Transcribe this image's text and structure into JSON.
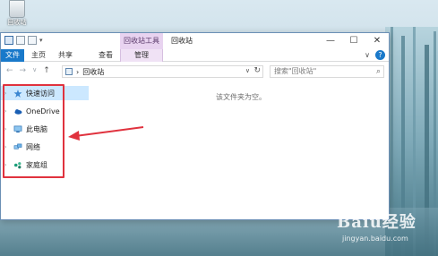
{
  "desktop": {
    "recycle_bin_label": "回收站"
  },
  "window": {
    "context_tab": "回收站工具",
    "title": "回收站",
    "controls": {
      "minimize": "—",
      "maximize": "☐",
      "close": "✕"
    }
  },
  "ribbon": {
    "tabs": [
      {
        "label": "文件"
      },
      {
        "label": "主页"
      },
      {
        "label": "共享"
      },
      {
        "label": "查看"
      },
      {
        "label": "管理"
      }
    ],
    "collapse": "∨",
    "help": "?"
  },
  "address": {
    "back": "←",
    "forward": "→",
    "recent": "∨",
    "up": "↑",
    "separator": "›",
    "path": "回收站",
    "dropdown": "∨",
    "refresh": "↻",
    "search_placeholder": "搜索\"回收站\"",
    "search_icon": "⌕"
  },
  "navpane": {
    "items": [
      {
        "label": "快速访问",
        "icon": "star-icon",
        "selected": true
      },
      {
        "label": "OneDrive",
        "icon": "cloud-icon",
        "selected": false
      },
      {
        "label": "此电脑",
        "icon": "computer-icon",
        "selected": false
      },
      {
        "label": "网络",
        "icon": "network-icon",
        "selected": false
      },
      {
        "label": "家庭组",
        "icon": "homegroup-icon",
        "selected": false
      }
    ]
  },
  "content": {
    "empty_message": "该文件夹为空。"
  },
  "watermark": {
    "brand": "Baiu经验",
    "url": "jingyan.baidu.com"
  },
  "colors": {
    "accent": "#1979ca",
    "annotation": "#e0323e",
    "selection": "#cce8ff",
    "context_tab": "#e8d3f0"
  }
}
